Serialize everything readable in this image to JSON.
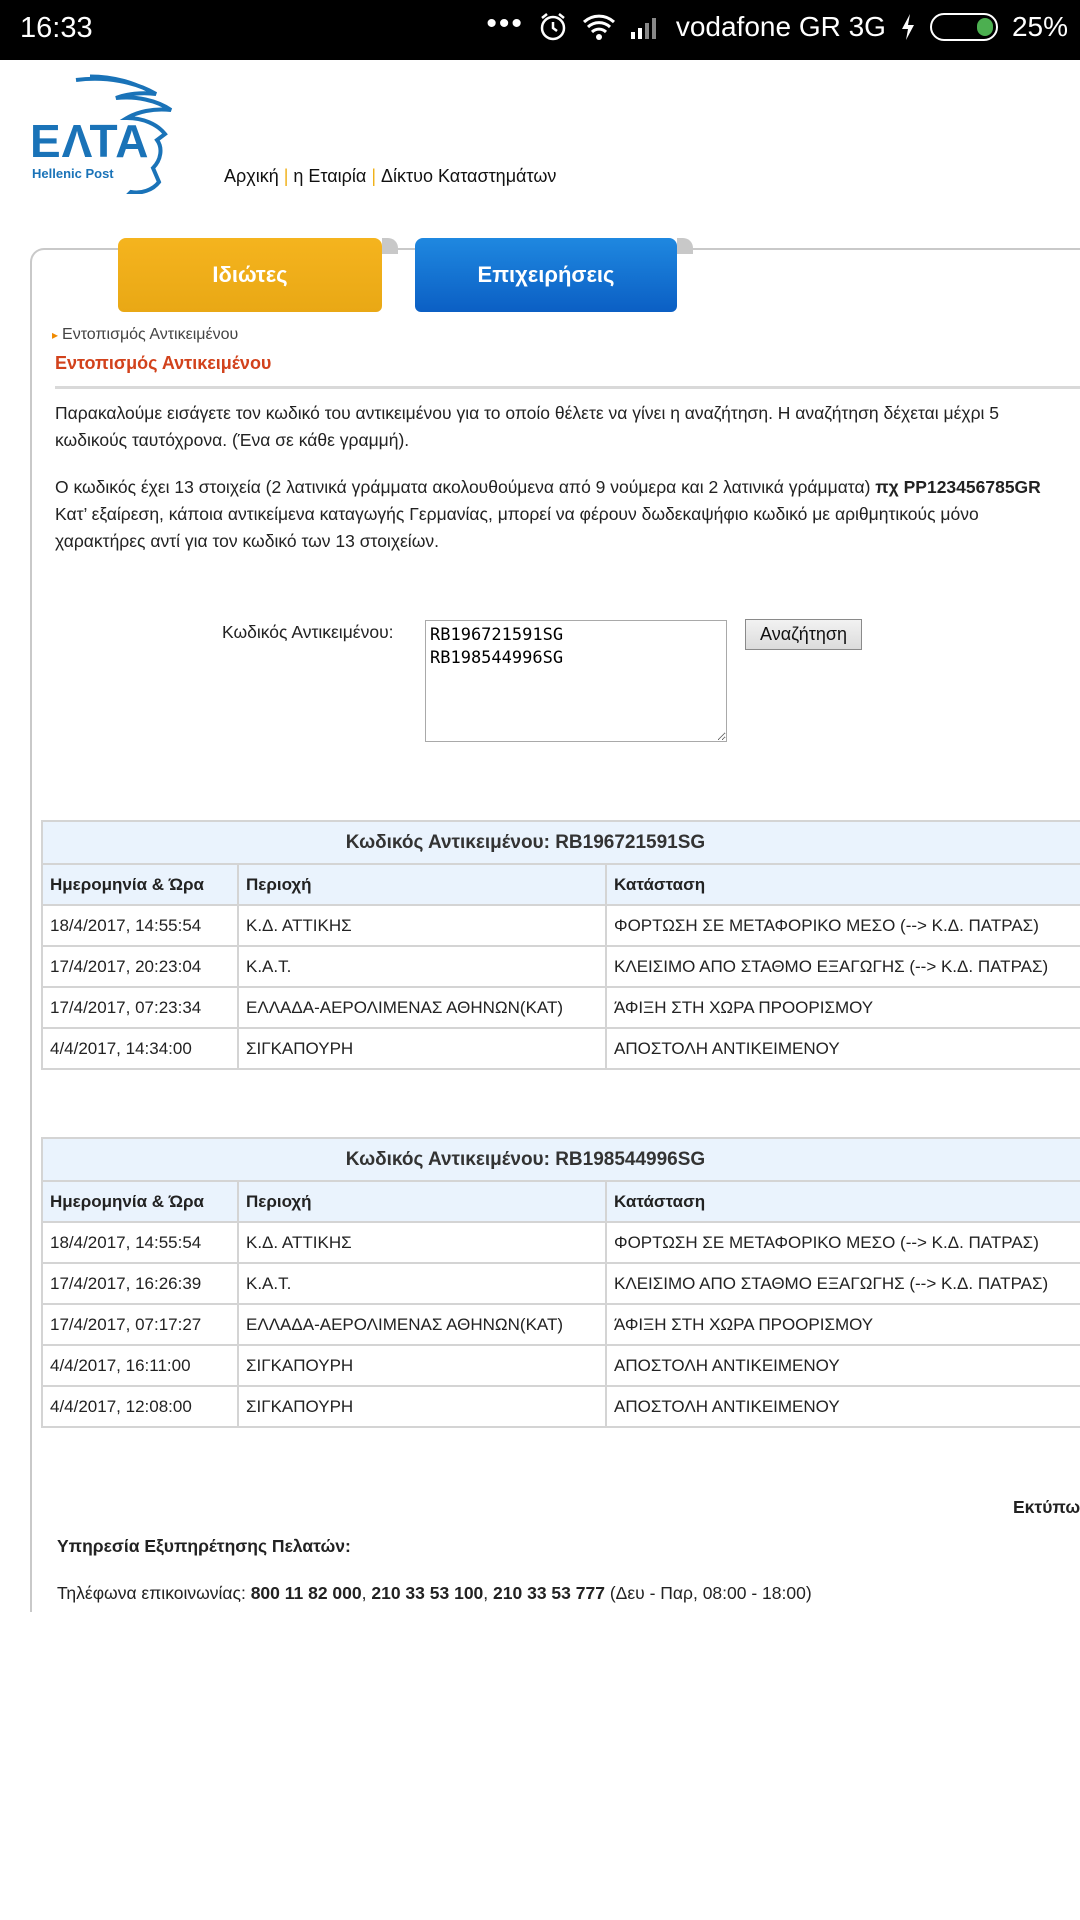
{
  "status_bar": {
    "time": "16:33",
    "dots": "•••",
    "carrier": "vodafone GR 3G",
    "battery": "25%",
    "icons": [
      "alarm-icon",
      "wifi-icon",
      "signal-icon",
      "charging-icon",
      "battery-icon"
    ]
  },
  "header": {
    "logo_text": "ΕΛΤΑ",
    "logo_sub": "Hellenic Post",
    "nav": [
      "Αρχική",
      "η Εταιρία",
      "Δίκτυο Καταστημάτων"
    ]
  },
  "tabs": {
    "private": "Ιδιώτες",
    "business": "Επιχειρήσεις"
  },
  "breadcrumb": "Εντοπισμός Αντικειμένου",
  "page_title": "Εντοπισμός Αντικειμένου",
  "intro": {
    "line1": "Παρακαλούμε εισάγετε τον κωδικό του αντικειμένου για το οποίο θέλετε να γίνει η αναζήτηση. Η αναζήτηση δέχεται μέχρι 5",
    "line2": "κωδικούς ταυτόχρονα. (Ένα σε κάθε γραμμή).",
    "line3_pre": "Ο κωδικός έχει 13 στοιχεία (2 λατινικά γράμματα ακολουθούμενα από 9 νούμερα και 2 λατινικά γράμματα) ",
    "line3_bold": "πχ PP123456785GR",
    "line4": "Κατ’ εξαίρεση, κάποια αντικείμενα καταγωγής Γερμανίας, μπορεί να φέρουν δωδεκαψήφιο κωδικό με αριθμητικούς μόνο",
    "line5": "χαρακτήρες αντί για τον κωδικό των 13 στοιχείων."
  },
  "form": {
    "label": "Κωδικός Αντικειμένου:",
    "codes_value": "RB196721591SG\nRB198544996SG",
    "search_button": "Αναζήτηση"
  },
  "results": [
    {
      "caption": "Κωδικός Αντικειμένου: RB196721591SG",
      "headers": [
        "Ημερομηνία & Ώρα",
        "Περιοχή",
        "Κατάσταση"
      ],
      "rows": [
        [
          "18/4/2017, 14:55:54",
          "Κ.Δ. ΑΤΤΙΚΗΣ",
          "ΦΟΡΤΩΣΗ ΣΕ ΜΕΤΑΦΟΡΙΚΟ ΜΕΣΟ (--> Κ.Δ. ΠΑΤΡΑΣ)"
        ],
        [
          "17/4/2017, 20:23:04",
          "Κ.Α.Τ.",
          "ΚΛΕΙΣΙΜΟ ΑΠΟ ΣΤΑΘΜΟ ΕΞΑΓΩΓΗΣ (--> Κ.Δ. ΠΑΤΡΑΣ)"
        ],
        [
          "17/4/2017, 07:23:34",
          "ΕΛΛΑΔΑ-ΑΕΡΟΛΙΜΕΝΑΣ ΑΘΗΝΩΝ(ΚΑΤ)",
          "ΆΦΙΞΗ ΣΤΗ ΧΩΡΑ ΠΡΟΟΡΙΣΜΟΥ"
        ],
        [
          "4/4/2017, 14:34:00",
          "ΣΙΓΚΑΠΟΥΡΗ",
          "ΑΠΟΣΤΟΛΗ ΑΝΤΙΚΕΙΜΕΝΟΥ"
        ]
      ]
    },
    {
      "caption": "Κωδικός Αντικειμένου: RB198544996SG",
      "headers": [
        "Ημερομηνία & Ώρα",
        "Περιοχή",
        "Κατάσταση"
      ],
      "rows": [
        [
          "18/4/2017, 14:55:54",
          "Κ.Δ. ΑΤΤΙΚΗΣ",
          "ΦΟΡΤΩΣΗ ΣΕ ΜΕΤΑΦΟΡΙΚΟ ΜΕΣΟ (--> Κ.Δ. ΠΑΤΡΑΣ)"
        ],
        [
          "17/4/2017, 16:26:39",
          "Κ.Α.Τ.",
          "ΚΛΕΙΣΙΜΟ ΑΠΟ ΣΤΑΘΜΟ ΕΞΑΓΩΓΗΣ (--> Κ.Δ. ΠΑΤΡΑΣ)"
        ],
        [
          "17/4/2017, 07:17:27",
          "ΕΛΛΑΔΑ-ΑΕΡΟΛΙΜΕΝΑΣ ΑΘΗΝΩΝ(ΚΑΤ)",
          "ΆΦΙΞΗ ΣΤΗ ΧΩΡΑ ΠΡΟΟΡΙΣΜΟΥ"
        ],
        [
          "4/4/2017, 16:11:00",
          "ΣΙΓΚΑΠΟΥΡΗ",
          "ΑΠΟΣΤΟΛΗ ΑΝΤΙΚΕΙΜΕΝΟΥ"
        ],
        [
          "4/4/2017, 12:08:00",
          "ΣΙΓΚΑΠΟΥΡΗ",
          "ΑΠΟΣΤΟΛΗ ΑΝΤΙΚΕΙΜΕΝΟΥ"
        ]
      ]
    }
  ],
  "print_link": "Εκτύπωση",
  "customer_service": {
    "title": "Υπηρεσία Εξυπηρέτησης Πελατών:",
    "phones_label": "Τηλέφωνα επικοινωνίας: ",
    "phones": [
      "800 11 82 000",
      "210 33 53 100",
      "210 33 53 777"
    ],
    "hours": " (Δευ - Παρ, 08:00 - 18:00)"
  },
  "colors": {
    "tab_private": "#f0b21a",
    "tab_business": "#0b6fd6",
    "title_accent": "#d2421c",
    "table_header_bg": "#eaf3fd",
    "logo_blue": "#1a73b8"
  }
}
